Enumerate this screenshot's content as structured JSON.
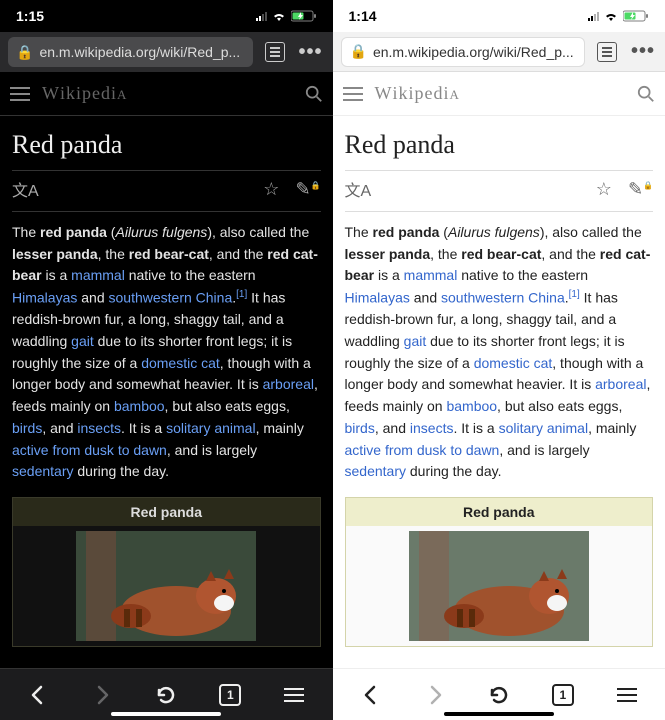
{
  "dark": {
    "status_time": "1:15",
    "url": "en.m.wikipedia.org/wiki/Red_p...",
    "wiki_brand": "WIKIPEDIA",
    "page_title": "Red panda",
    "infobox_title": "Red panda",
    "tab_count": "1"
  },
  "light": {
    "status_time": "1:14",
    "url": "en.m.wikipedia.org/wiki/Red_p...",
    "wiki_brand": "WIKIPEDIA",
    "page_title": "Red panda",
    "infobox_title": "Red panda",
    "tab_count": "1"
  },
  "article": {
    "t1": "The ",
    "b1": "red panda",
    "t2": " (",
    "i1": "Ailurus fulgens",
    "t3": "), also called the ",
    "b2": "lesser panda",
    "t4": ", the ",
    "b3": "red bear-cat",
    "t5": ", and the ",
    "b4": "red cat-bear",
    "t6": " is a ",
    "l1": "mammal",
    "t7": " native to the eastern ",
    "l2": "Himalayas",
    "t8": " and ",
    "l3": "southwestern China",
    "t9": ".",
    "sup1": "[1]",
    "t10": " It has reddish-brown fur, a long, shaggy tail, and a waddling ",
    "l4": "gait",
    "t11": " due to its shorter front legs; it is roughly the size of a ",
    "l5": "domestic cat",
    "t12": ", though with a longer body and somewhat heavier. It is ",
    "l6": "arboreal",
    "t13": ", feeds mainly on ",
    "l7": "bamboo",
    "t14": ", but also eats eggs, ",
    "l8": "birds",
    "t15": ", and ",
    "l9": "insects",
    "t16": ". It is a ",
    "l10": "solitary animal",
    "t17": ", mainly ",
    "l11": "active from dusk to dawn",
    "t18": ", and is largely ",
    "l12": "sedentary",
    "t19": " during the day."
  }
}
